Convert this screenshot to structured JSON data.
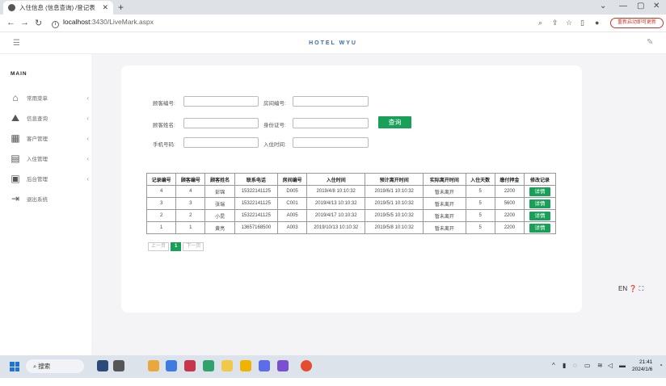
{
  "browser": {
    "tab_title": "入住信息 (信息查询) /登记表",
    "new_tab": "+",
    "url_host": "localhost",
    "url_path": ":3430/LiveMark.aspx",
    "update_button": "重新启动即可更新",
    "min_glyph": "—",
    "max_glyph": "▢",
    "close_glyph": "✕"
  },
  "header": {
    "brand": "HOTEL WYU"
  },
  "sidebar": {
    "title": "MAIN",
    "items": [
      {
        "label": "常用菜单",
        "icon": "home-icon"
      },
      {
        "label": "信息查询",
        "icon": "chart-icon"
      },
      {
        "label": "客户管理",
        "icon": "calendar-icon"
      },
      {
        "label": "入住管理",
        "icon": "clipboard-icon"
      },
      {
        "label": "后台管理",
        "icon": "grid-icon"
      },
      {
        "label": "退出系统",
        "icon": "logout-icon"
      }
    ]
  },
  "form": {
    "guest_no_label": "顾客编号:",
    "room_no_label": "房间编号:",
    "guest_name_label": "顾客姓名:",
    "id_card_label": "身份证号:",
    "phone_label": "手机号码:",
    "checkin_time_label": "入住时间:",
    "query_button": "查询"
  },
  "table": {
    "headers": [
      "记录编号",
      "顾客编号",
      "顾客姓名",
      "联系电话",
      "房间编号",
      "入住时间",
      "预计离开时间",
      "实际离开时间",
      "入住天数",
      "缴付押金",
      "修改记录"
    ],
    "rows": [
      [
        "4",
        "4",
        "彭锦",
        "15322141125",
        "D005",
        "2019/4/8 10:10:32",
        "2019/6/1 10:10:32",
        "暂未离开",
        "5",
        "2200",
        "详情"
      ],
      [
        "3",
        "3",
        "张瑞",
        "15322141125",
        "C001",
        "2019/4/13 10:10:32",
        "2019/5/1 10:10:32",
        "暂未离开",
        "5",
        "5600",
        "详情"
      ],
      [
        "2",
        "2",
        "小昆",
        "15322141125",
        "A005",
        "2019/4/17 10:10:32",
        "2019/5/5 10:10:32",
        "暂未离开",
        "5",
        "2200",
        "详情"
      ],
      [
        "1",
        "1",
        "黄亮",
        "13657168500",
        "A003",
        "2019/10/13 10:10:32",
        "2019/5/8 10:10:32",
        "暂未离开",
        "5",
        "2200",
        "详情"
      ]
    ]
  },
  "pager": {
    "prev": "上一页",
    "current": "1",
    "next": "下一页"
  },
  "float_tools": "EN",
  "taskbar": {
    "search_label": "搜索",
    "time": "21:41",
    "date": "2024/1/6"
  }
}
